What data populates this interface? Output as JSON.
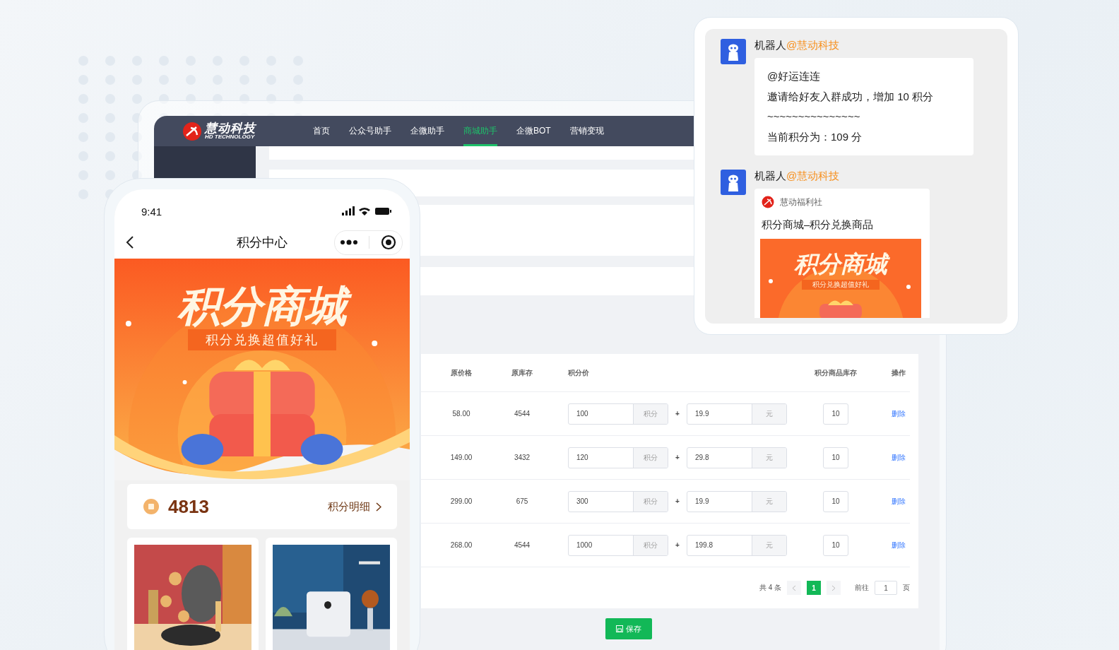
{
  "admin": {
    "logo": {
      "name": "慧动科技",
      "subtitle": "HD TECHNOLOGY"
    },
    "nav": [
      {
        "label": "首页",
        "selected": false
      },
      {
        "label": "公众号助手",
        "selected": false
      },
      {
        "label": "企微助手",
        "selected": false
      },
      {
        "label": "商城助手",
        "selected": true
      },
      {
        "label": "企微BOT",
        "selected": false
      },
      {
        "label": "营销变现",
        "selected": false
      }
    ],
    "table": {
      "columns": [
        "原价格",
        "原库存",
        "积分价",
        "积分商品库存",
        "操作"
      ],
      "rows": [
        {
          "price": "58.00",
          "stock": "4544",
          "points": "100",
          "points_unit": "积分",
          "plus": "+",
          "cash": "19.9",
          "cash_unit": "元",
          "points_stock": "10",
          "action": "删除"
        },
        {
          "price": "149.00",
          "stock": "3432",
          "points": "120",
          "points_unit": "积分",
          "plus": "+",
          "cash": "29.8",
          "cash_unit": "元",
          "points_stock": "10",
          "action": "删除"
        },
        {
          "price": "299.00",
          "stock": "675",
          "points": "300",
          "points_unit": "积分",
          "plus": "+",
          "cash": "19.9",
          "cash_unit": "元",
          "points_stock": "10",
          "action": "删除"
        },
        {
          "price": "268.00",
          "stock": "4544",
          "points": "1000",
          "points_unit": "积分",
          "plus": "+",
          "cash": "199.8",
          "cash_unit": "元",
          "points_stock": "10",
          "action": "删除"
        }
      ]
    },
    "pagination": {
      "total": "共 4 条",
      "pages": [
        {
          "label": "1",
          "selected": true
        }
      ],
      "goto_label": "前往",
      "goto_value": "1",
      "page_suffix": "页"
    },
    "save_button": "保存"
  },
  "phone": {
    "time": "9:41",
    "title": "积分中心",
    "banner": {
      "title": "积分商城",
      "subtitle": "积分兑换超值好礼"
    },
    "points": "4813",
    "points_link": "积分明细"
  },
  "chat": {
    "messages": [
      {
        "sender": "机器人",
        "mention": "@慧动科技",
        "kind": "text",
        "lines": [
          "@好运连连",
          "邀请给好友入群成功，增加 10 积分",
          "~~~~~~~~~~~~~~~",
          "当前积分为：109 分"
        ]
      },
      {
        "sender": "机器人",
        "mention": "@慧动科技",
        "kind": "card",
        "source": "慧动福利社",
        "title": "积分商城–积分兑换商品",
        "banner": {
          "title": "积分商城",
          "subtitle": "积分兑换超值好礼"
        }
      }
    ]
  }
}
